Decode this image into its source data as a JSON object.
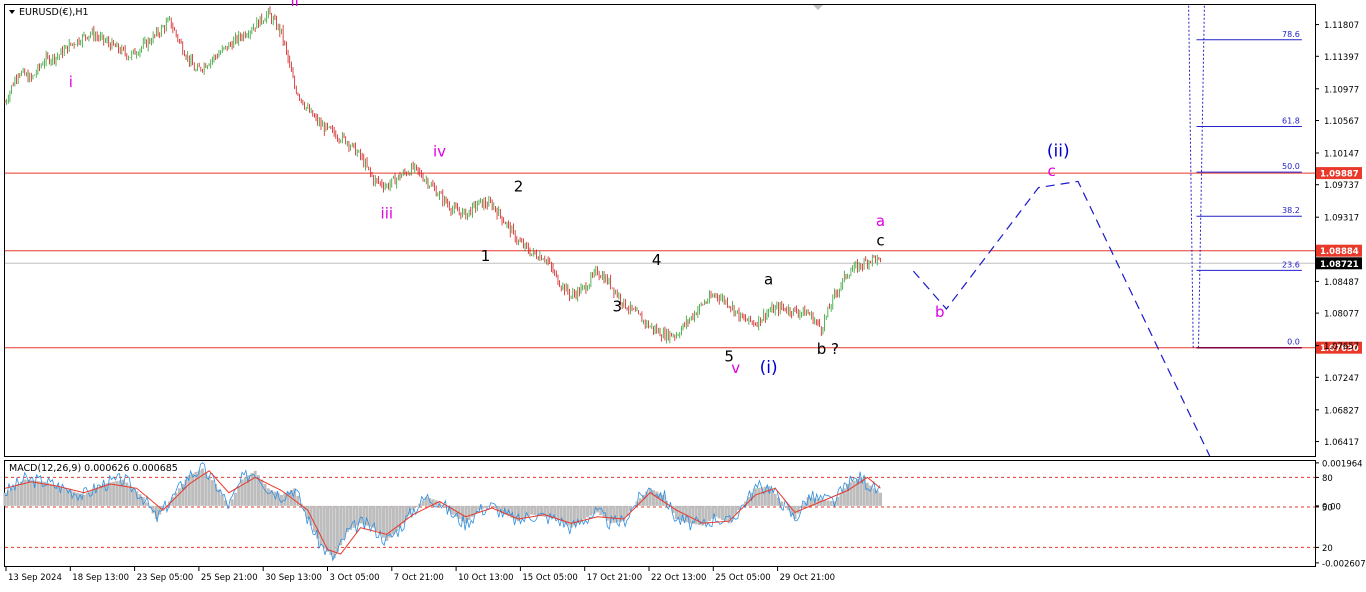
{
  "chart_data": [
    {
      "type": "candlestick",
      "symbol_label": "EURUSD(€),H1",
      "ylim": [
        1.0623,
        1.1206
      ],
      "price_ticks": [
        "1.11807",
        "1.11397",
        "1.10977",
        "1.10567",
        "1.10147",
        "1.09737",
        "1.09317",
        "1.08487",
        "1.08077",
        "1.07657",
        "1.07247",
        "1.06827",
        "1.06417"
      ],
      "highlight_levels": [
        {
          "price": 1.09887,
          "label": "1.09887",
          "color": "#e8392b"
        },
        {
          "price": 1.08884,
          "label": "1.08884",
          "color": "#e8392b"
        },
        {
          "price": 1.08721,
          "label": "1.08721",
          "color": "#000000"
        },
        {
          "price": 1.0763,
          "label": "1.07630",
          "color": "#e8392b"
        }
      ],
      "x_ticks": [
        "13 Sep 2024",
        "18 Sep 13:00",
        "23 Sep 05:00",
        "25 Sep 21:00",
        "30 Sep 13:00",
        "3 Oct 05:00",
        "7 Oct 21:00",
        "10 Oct 13:00",
        "15 Oct 05:00",
        "17 Oct 21:00",
        "22 Oct 13:00",
        "25 Oct 05:00",
        "29 Oct 21:00"
      ],
      "price_path": [
        [
          0,
          1.108
        ],
        [
          2,
          1.112
        ],
        [
          4,
          1.111
        ],
        [
          6,
          1.1135
        ],
        [
          8,
          1.114
        ],
        [
          10,
          1.1155
        ],
        [
          13,
          1.117
        ],
        [
          16,
          1.1155
        ],
        [
          19,
          1.114
        ],
        [
          22,
          1.116
        ],
        [
          25,
          1.1185
        ],
        [
          27,
          1.115
        ],
        [
          29,
          1.112
        ],
        [
          32,
          1.114
        ],
        [
          35,
          1.116
        ],
        [
          38,
          1.118
        ],
        [
          40,
          1.1195
        ],
        [
          42,
          1.117
        ],
        [
          44,
          1.11
        ],
        [
          46,
          1.107
        ],
        [
          48,
          1.105
        ],
        [
          50,
          1.104
        ],
        [
          52,
          1.103
        ],
        [
          54,
          1.101
        ],
        [
          56,
          1.098
        ],
        [
          58,
          1.0972
        ],
        [
          60,
          1.0985
        ],
        [
          62,
          1.0995
        ],
        [
          64,
          1.098
        ],
        [
          66,
          1.096
        ],
        [
          68,
          1.0942
        ],
        [
          70,
          1.0935
        ],
        [
          72,
          1.095
        ],
        [
          74,
          1.0948
        ],
        [
          76,
          1.0925
        ],
        [
          78,
          1.09
        ],
        [
          80,
          1.0885
        ],
        [
          82,
          1.088
        ],
        [
          84,
          1.085
        ],
        [
          86,
          1.083
        ],
        [
          88,
          1.084
        ],
        [
          90,
          1.0862
        ],
        [
          92,
          1.0845
        ],
        [
          94,
          1.082
        ],
        [
          96,
          1.0805
        ],
        [
          98,
          1.079
        ],
        [
          100,
          1.078
        ],
        [
          102,
          1.078
        ],
        [
          104,
          1.08
        ],
        [
          106,
          1.082
        ],
        [
          108,
          1.0832
        ],
        [
          110,
          1.082
        ],
        [
          112,
          1.08
        ],
        [
          114,
          1.0795
        ],
        [
          116,
          1.081
        ],
        [
          118,
          1.0815
        ],
        [
          120,
          1.081
        ],
        [
          122,
          1.0808
        ],
        [
          124,
          1.0788
        ],
        [
          126,
          1.083
        ],
        [
          128,
          1.086
        ],
        [
          130,
          1.087
        ],
        [
          132,
          1.088
        ],
        [
          133,
          1.0872
        ]
      ],
      "wave_labels": [
        {
          "text": "i",
          "t": 10,
          "price": 1.11,
          "color": "#e000e0"
        },
        {
          "text": "ii",
          "t": 44,
          "price": 1.1205,
          "color": "#e000e0"
        },
        {
          "text": "iii",
          "t": 58,
          "price": 1.093,
          "color": "#e000e0"
        },
        {
          "text": "iv",
          "t": 66,
          "price": 1.101,
          "color": "#e000e0"
        },
        {
          "text": "v",
          "t": 111,
          "price": 1.073,
          "color": "#e000e0"
        },
        {
          "text": "a",
          "t": 133,
          "price": 1.092,
          "color": "#e000e0"
        },
        {
          "text": "b",
          "t": 142,
          "price": 1.0803,
          "color": "#e000e0"
        },
        {
          "text": "c",
          "t": 159,
          "price": 1.0985,
          "color": "#e000e0"
        },
        {
          "text": "(i)",
          "t": 116,
          "price": 1.073,
          "color": "#0000cc"
        },
        {
          "text": "(ii)",
          "t": 160,
          "price": 1.101,
          "color": "#0000cc"
        },
        {
          "text": "1",
          "t": 73,
          "price": 1.0875,
          "color": "#000000"
        },
        {
          "text": "2",
          "t": 78,
          "price": 1.0965,
          "color": "#000000"
        },
        {
          "text": "3",
          "t": 93,
          "price": 1.081,
          "color": "#000000"
        },
        {
          "text": "4",
          "t": 99,
          "price": 1.087,
          "color": "#000000"
        },
        {
          "text": "5",
          "t": 110,
          "price": 1.0745,
          "color": "#000000"
        },
        {
          "text": "a",
          "t": 116,
          "price": 1.0845,
          "color": "#000000"
        },
        {
          "text": "b ?",
          "t": 125,
          "price": 1.0755,
          "color": "#000000"
        },
        {
          "text": "c",
          "t": 133,
          "price": 1.0895,
          "color": "#000000"
        }
      ],
      "projection_path": [
        [
          138,
          1.0862
        ],
        [
          143,
          1.0813
        ],
        [
          157,
          1.097
        ],
        [
          163,
          1.0978
        ],
        [
          183,
          1.0623
        ]
      ],
      "fibonacci": {
        "t_start": 181,
        "t_end": 197,
        "anchor_high": 1.1206,
        "levels": [
          {
            "label": "78.6",
            "price": 1.1161
          },
          {
            "label": "61.8",
            "price": 1.1049
          },
          {
            "label": "50.0",
            "price": 1.099
          },
          {
            "label": "38.2",
            "price": 1.0933
          },
          {
            "label": "23.6",
            "price": 1.0863
          },
          {
            "label": "0.0",
            "price": 1.0763
          }
        ]
      }
    },
    {
      "type": "area",
      "title": "MACD(12,26,9) 0.000626 0.000685",
      "ylim": [
        -0.00275,
        0.00205
      ],
      "tick_labels": [
        {
          "label": "0.001964",
          "value": 0.001964
        },
        {
          "label": "80",
          "value": 0.0013
        },
        {
          "label": "0.00",
          "value": 0.0
        },
        {
          "label": "50",
          "value": -5e-05
        },
        {
          "label": "20",
          "value": -0.0019
        },
        {
          "label": "-0.002607",
          "value": -0.002607
        }
      ],
      "reference_lines": [
        0.0013,
        -5e-05,
        -0.0019
      ],
      "histogram": [
        [
          0,
          0.0006
        ],
        [
          3,
          0.0012
        ],
        [
          6,
          0.0011
        ],
        [
          9,
          0.0008
        ],
        [
          12,
          0.0005
        ],
        [
          15,
          0.001
        ],
        [
          18,
          0.0012
        ],
        [
          21,
          0.0004
        ],
        [
          23,
          -0.0006
        ],
        [
          25,
          0.0002
        ],
        [
          28,
          0.0014
        ],
        [
          30,
          0.0017
        ],
        [
          32,
          0.001
        ],
        [
          34,
          0.0
        ],
        [
          36,
          0.0012
        ],
        [
          38,
          0.0016
        ],
        [
          40,
          0.0008
        ],
        [
          42,
          0.0005
        ],
        [
          44,
          0.0008
        ],
        [
          46,
          -0.0006
        ],
        [
          48,
          -0.0018
        ],
        [
          50,
          -0.0024
        ],
        [
          52,
          -0.0012
        ],
        [
          54,
          -0.0008
        ],
        [
          56,
          -0.001
        ],
        [
          58,
          -0.0016
        ],
        [
          60,
          -0.001
        ],
        [
          62,
          -0.0002
        ],
        [
          64,
          0.0004
        ],
        [
          66,
          0.0002
        ],
        [
          68,
          -0.0004
        ],
        [
          70,
          -0.0008
        ],
        [
          72,
          -0.0002
        ],
        [
          74,
          0.0
        ],
        [
          76,
          -0.0004
        ],
        [
          78,
          -0.0007
        ],
        [
          80,
          -0.0004
        ],
        [
          82,
          -0.0005
        ],
        [
          84,
          -0.0006
        ],
        [
          86,
          -0.001
        ],
        [
          88,
          -0.0006
        ],
        [
          90,
          -0.0003
        ],
        [
          92,
          -0.0008
        ],
        [
          94,
          -0.0007
        ],
        [
          96,
          0.0002
        ],
        [
          98,
          0.0008
        ],
        [
          100,
          0.0005
        ],
        [
          102,
          -0.0006
        ],
        [
          104,
          -0.0008
        ],
        [
          106,
          -0.0009
        ],
        [
          108,
          -0.0005
        ],
        [
          110,
          -0.0008
        ],
        [
          112,
          0.0
        ],
        [
          114,
          0.0008
        ],
        [
          116,
          0.0009
        ],
        [
          118,
          0.0002
        ],
        [
          120,
          -0.0006
        ],
        [
          122,
          0.0004
        ],
        [
          124,
          0.0003
        ],
        [
          126,
          0.0002
        ],
        [
          128,
          0.001
        ],
        [
          130,
          0.0013
        ],
        [
          132,
          0.0008
        ],
        [
          133,
          0.0006
        ]
      ],
      "signal": [
        [
          0,
          0.0008
        ],
        [
          4,
          0.0011
        ],
        [
          8,
          0.0009
        ],
        [
          12,
          0.0006
        ],
        [
          16,
          0.001
        ],
        [
          20,
          0.0008
        ],
        [
          24,
          -0.0002
        ],
        [
          28,
          0.001
        ],
        [
          31,
          0.0016
        ],
        [
          34,
          0.0006
        ],
        [
          38,
          0.0013
        ],
        [
          42,
          0.0007
        ],
        [
          46,
          -0.0002
        ],
        [
          49,
          -0.002
        ],
        [
          51,
          -0.0022
        ],
        [
          54,
          -0.001
        ],
        [
          58,
          -0.0013
        ],
        [
          62,
          -0.0004
        ],
        [
          66,
          0.0002
        ],
        [
          70,
          -0.0005
        ],
        [
          74,
          -0.0001
        ],
        [
          78,
          -0.0006
        ],
        [
          82,
          -0.0004
        ],
        [
          86,
          -0.0008
        ],
        [
          90,
          -0.0005
        ],
        [
          94,
          -0.0006
        ],
        [
          98,
          0.0006
        ],
        [
          102,
          -0.0002
        ],
        [
          106,
          -0.0008
        ],
        [
          110,
          -0.0007
        ],
        [
          114,
          0.0005
        ],
        [
          117,
          0.0008
        ],
        [
          120,
          -0.0003
        ],
        [
          124,
          0.0002
        ],
        [
          128,
          0.0007
        ],
        [
          131,
          0.0013
        ],
        [
          133,
          0.0008
        ]
      ],
      "signal_color": "#e8392b",
      "histogram_color": "#bdbdbd",
      "main_line_color": "#2f8fe0"
    }
  ]
}
